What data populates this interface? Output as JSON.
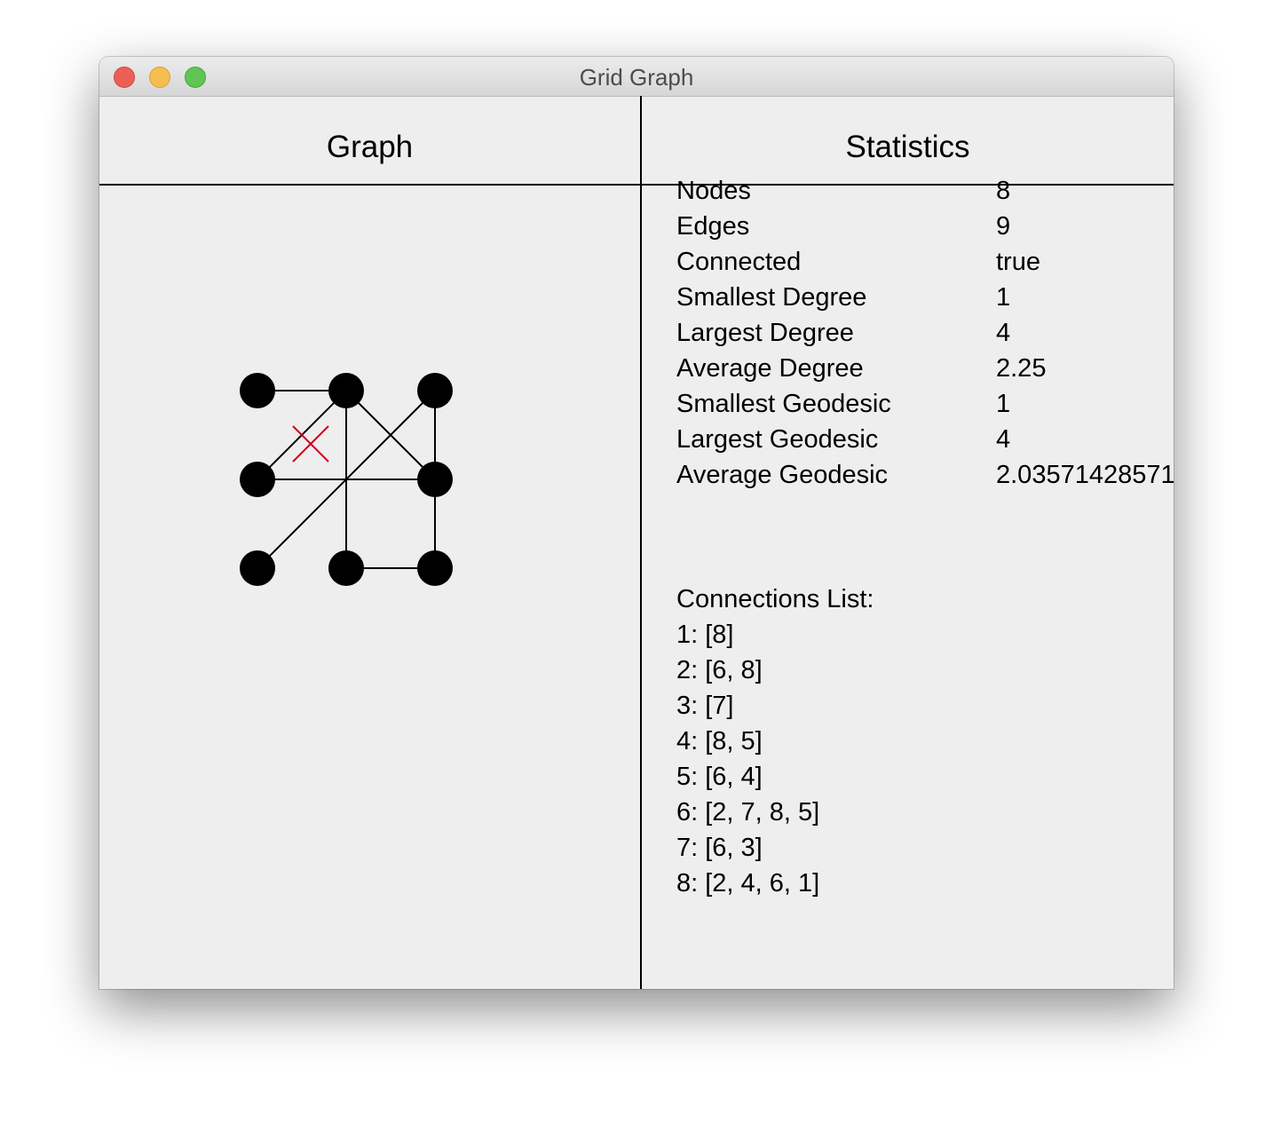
{
  "window": {
    "title": "Grid Graph"
  },
  "graph_panel": {
    "header": "Graph",
    "node_color": "#000000",
    "edge_color": "#000000",
    "marker_color": "#d0021b",
    "marker_icon": "red-x-mark"
  },
  "stats_panel": {
    "header": "Statistics",
    "rows": [
      {
        "label": "Nodes",
        "value": "8"
      },
      {
        "label": "Edges",
        "value": "9"
      },
      {
        "label": "Connected",
        "value": "true"
      },
      {
        "label": "Smallest Degree",
        "value": "1"
      },
      {
        "label": "Largest Degree",
        "value": "4"
      },
      {
        "label": "Average Degree",
        "value": "2.25"
      },
      {
        "label": "Smallest Geodesic",
        "value": "1"
      },
      {
        "label": "Largest Geodesic",
        "value": "4"
      },
      {
        "label": "Average Geodesic",
        "value": "2.03571428571"
      }
    ],
    "connections_title": "Connections List:",
    "connections": [
      "1: [8]",
      "2: [6, 8]",
      "3: [7]",
      "4: [8, 5]",
      "5: [6, 4]",
      "6: [2, 7, 8, 5]",
      "7: [6, 3]",
      "8: [2, 4, 6, 1]"
    ]
  }
}
